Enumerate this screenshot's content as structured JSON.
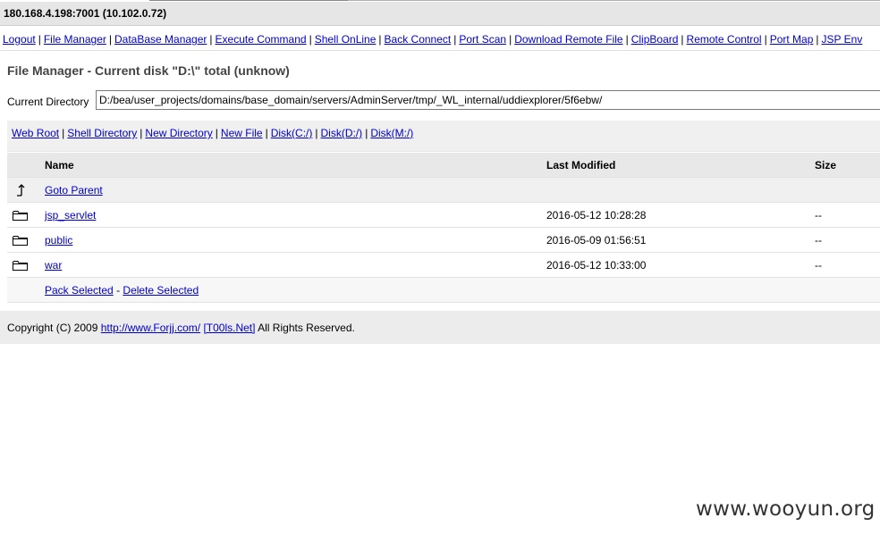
{
  "window": {
    "title": "180.168.4.198:7001 (10.102.0.72)"
  },
  "nav": {
    "items": [
      "Logout",
      "File Manager",
      "DataBase Manager",
      "Execute Command",
      "Shell OnLine",
      "Back Connect",
      "Port Scan",
      "Download Remote File",
      "ClipBoard",
      "Remote Control",
      "Port Map",
      "JSP Env"
    ]
  },
  "page": {
    "title": "File Manager - Current disk \"D:\\\" total (unknow)",
    "current_dir_label": "Current Directory",
    "current_dir_value": "D:/bea/user_projects/domains/base_domain/servers/AdminServer/tmp/_WL_internal/uddiexplorer/5f6ebw/"
  },
  "quick_links": [
    "Web Root",
    "Shell Directory",
    "New Directory",
    "New File",
    "Disk(C:/)",
    "Disk(D:/)",
    "Disk(M:/)"
  ],
  "table": {
    "headers": {
      "name": "Name",
      "modified": "Last Modified",
      "size": "Size"
    },
    "parent_label": "Goto Parent",
    "rows": [
      {
        "name": "jsp_servlet",
        "modified": "2016-05-12 10:28:28",
        "size": "--"
      },
      {
        "name": "public",
        "modified": "2016-05-09 01:56:51",
        "size": "--"
      },
      {
        "name": "war",
        "modified": "2016-05-12 10:33:00",
        "size": "--"
      }
    ],
    "actions": {
      "pack": "Pack Selected",
      "separator": "-",
      "delete": "Delete Selected"
    }
  },
  "footer": {
    "prefix": "Copyright (C) 2009",
    "link1": "http://www.Forjj.com/",
    "link2": "[T00ls.Net]",
    "suffix": "All Rights Reserved."
  },
  "watermark": "www.wooyun.org"
}
